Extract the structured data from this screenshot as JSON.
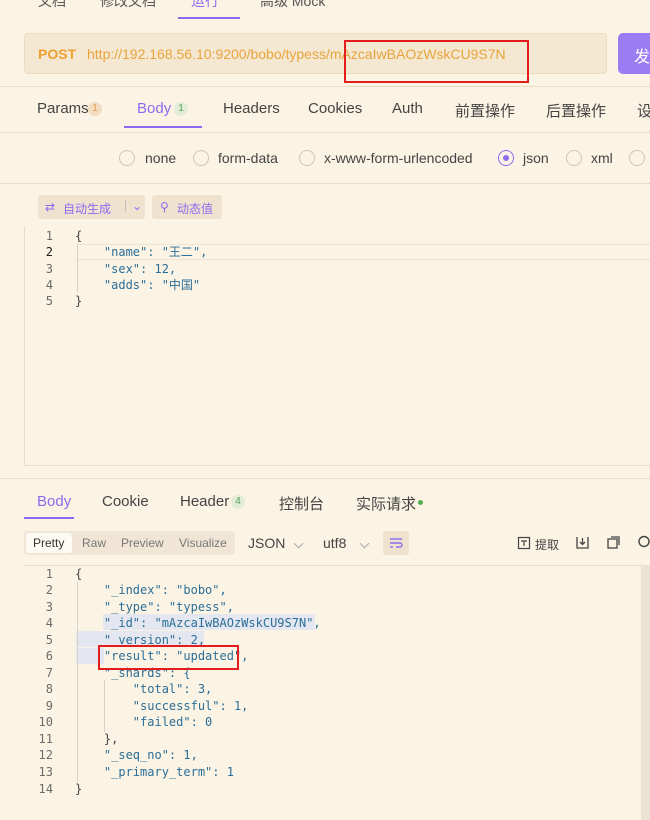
{
  "top_tabs": [
    {
      "label": "文档",
      "active": false
    },
    {
      "label": "修改文档",
      "active": false
    },
    {
      "label": "运行",
      "active": true
    },
    {
      "label": "高级 Mock",
      "active": false
    }
  ],
  "request": {
    "method": "POST",
    "url": "http://192.168.56.10:9200/bobo/typess/mAzcaIwBAOzWskCU9S7N",
    "send_label": "发"
  },
  "request_tabs": [
    {
      "label": "Params",
      "badge": "1"
    },
    {
      "label": "Body",
      "badge": "1",
      "active": true
    },
    {
      "label": "Headers"
    },
    {
      "label": "Cookies"
    },
    {
      "label": "Auth"
    },
    {
      "label": "前置操作"
    },
    {
      "label": "后置操作"
    },
    {
      "label": "设"
    }
  ],
  "body_types": [
    {
      "label": "none",
      "checked": false
    },
    {
      "label": "form-data",
      "checked": false
    },
    {
      "label": "x-www-form-urlencoded",
      "checked": false
    },
    {
      "label": "json",
      "checked": true
    },
    {
      "label": "xml",
      "checked": false
    }
  ],
  "editor_buttons": {
    "auto_generate": "自动生成",
    "dynamic_value": "动态值"
  },
  "request_body": {
    "line_numbers": [
      "1",
      "2",
      "3",
      "4",
      "5"
    ],
    "lines": [
      "{",
      "    \"name\": \"王二\",",
      "    \"sex\": 12,",
      "    \"adds\": \"中国\"",
      "}"
    ]
  },
  "response_tabs": [
    {
      "label": "Body",
      "active": true
    },
    {
      "label": "Cookie"
    },
    {
      "label": "Header",
      "badge": "4"
    },
    {
      "label": "控制台"
    },
    {
      "label": "实际请求"
    }
  ],
  "response_toolbar": {
    "view_modes": [
      "Pretty",
      "Raw",
      "Preview",
      "Visualize"
    ],
    "active_mode": "Pretty",
    "format": "JSON",
    "encoding": "utf8",
    "extract_label": "提取"
  },
  "response_body": {
    "line_numbers": [
      "1",
      "2",
      "3",
      "4",
      "5",
      "6",
      "7",
      "8",
      "9",
      "10",
      "11",
      "12",
      "13",
      "14"
    ],
    "lines": [
      "{",
      "    \"_index\": \"bobo\",",
      "    \"_type\": \"typess\",",
      "    \"_id\": \"mAzcaIwBAOzWskCU9S7N\",",
      "    \"_version\": 2,",
      "    \"result\": \"updated\",",
      "    \"_shards\": {",
      "        \"total\": 3,",
      "        \"successful\": 1,",
      "        \"failed\": 0",
      "    },",
      "    \"_seq_no\": 1,",
      "    \"_primary_term\": 1",
      "}"
    ]
  },
  "colors": {
    "accent": "#8b6cf0",
    "method": "#f0a030",
    "highlight_box": "#e31d1d"
  }
}
